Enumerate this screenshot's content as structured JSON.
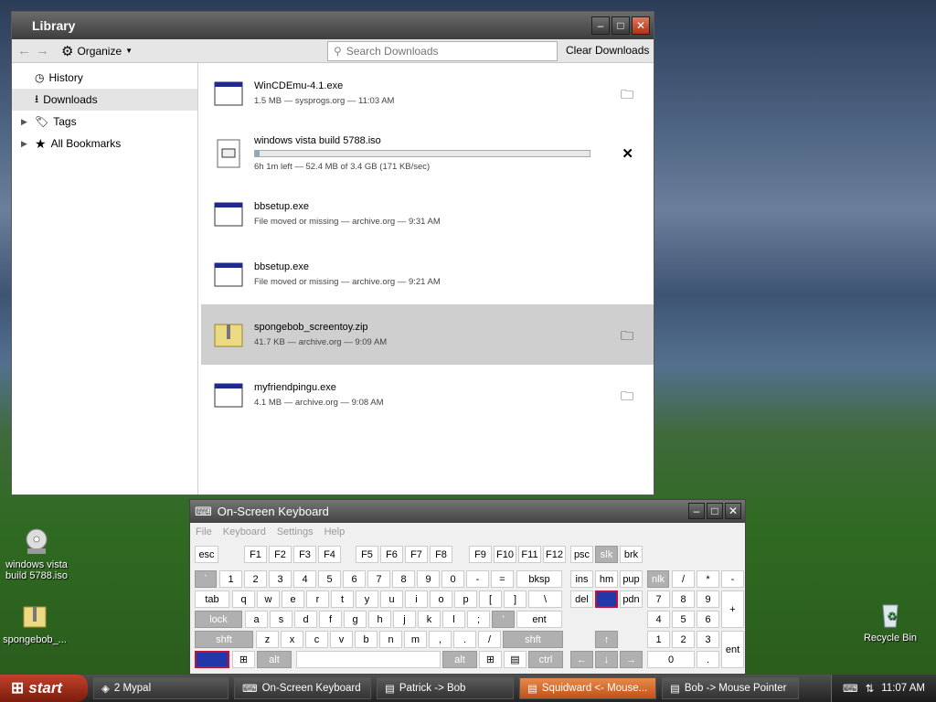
{
  "library": {
    "title": "Library",
    "toolbar": {
      "organize": "Organize",
      "search_placeholder": "Search Downloads",
      "clear": "Clear Downloads"
    },
    "sidebar": [
      {
        "label": "History",
        "icon": "clock-icon"
      },
      {
        "label": "Downloads",
        "icon": "download-icon",
        "selected": true
      },
      {
        "label": "Tags",
        "icon": "tag-icon"
      },
      {
        "label": "All Bookmarks",
        "icon": "star-icon"
      }
    ],
    "downloads": [
      {
        "name": "WinCDEmu-4.1.exe",
        "meta": "1.5 MB — sysprogs.org — 11:03 AM",
        "action": "folder-icon"
      },
      {
        "name": "windows vista build 5788.iso",
        "meta": "6h 1m left — 52.4 MB of 3.4 GB (171 KB/sec)",
        "action": "cancel-icon",
        "progress": 0.015
      },
      {
        "name": "bbsetup.exe",
        "meta": "File moved or missing — archive.org — 9:31 AM"
      },
      {
        "name": "bbsetup.exe",
        "meta": "File moved or missing — archive.org — 9:21 AM"
      },
      {
        "name": "spongebob_screentoy.zip",
        "meta": "41.7 KB — archive.org — 9:09 AM",
        "action": "folder-icon",
        "selected": true
      },
      {
        "name": "myfriendpingu.exe",
        "meta": "4.1 MB — archive.org — 9:08 AM",
        "action": "folder-icon"
      }
    ]
  },
  "osk": {
    "title": "On-Screen Keyboard",
    "menu": [
      "File",
      "Keyboard",
      "Settings",
      "Help"
    ]
  },
  "desktop": {
    "icons": [
      {
        "label": "windows vista build 5788.iso"
      },
      {
        "label": "spongebob_..."
      },
      {
        "label": "Recycle Bin"
      }
    ]
  },
  "taskbar": {
    "start": "start",
    "tasks": [
      "2 Mypal",
      "On-Screen Keyboard",
      "Patrick -> Bob",
      "Squidward <- Mouse...",
      "Bob -> Mouse Pointer"
    ],
    "clock": "11:07 AM"
  }
}
